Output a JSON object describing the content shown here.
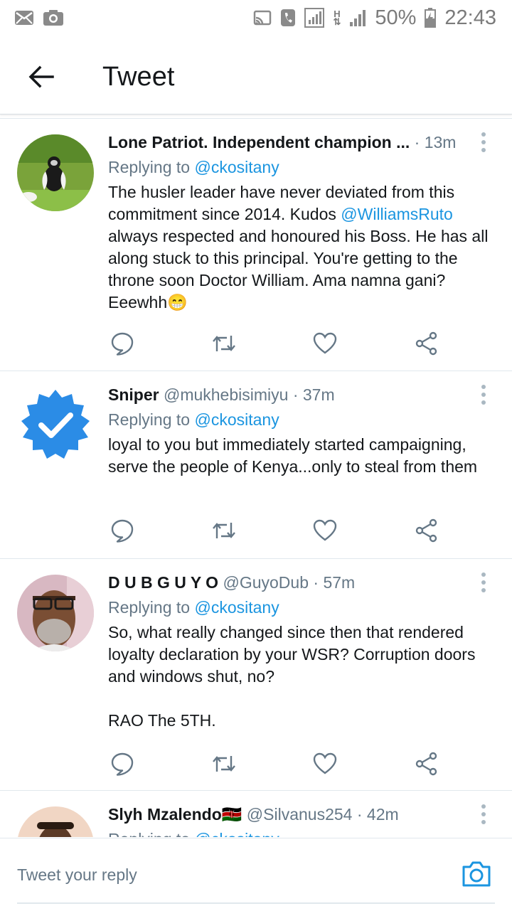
{
  "status_bar": {
    "battery": "50%",
    "time": "22:43",
    "network": "H"
  },
  "app_bar": {
    "title": "Tweet"
  },
  "tweets": [
    {
      "name": "Lone Patriot. Independent champion ...",
      "handle": "",
      "time": "13m",
      "replying_label": "Replying to ",
      "replying_to": "@ckositany",
      "lines": [
        "The husler leader have never deviated from this commitment since 2014. Kudos ",
        "@WilliamsRuto",
        " always respected and honoured his Boss. He has all along stuck to this principal. You're getting to the throne soon Doctor William. Ama namna gani? Eeewhh😁"
      ]
    },
    {
      "name": "Sniper",
      "handle": "@mukhebisimiyu",
      "time": "37m",
      "replying_label": "Replying to ",
      "replying_to": "@ckositany",
      "text": "loyal to you but immediately started campaigning, serve the people of Kenya...only to steal from them"
    },
    {
      "name": "D U B G U Y O",
      "handle": "@GuyoDub",
      "time": "57m",
      "replying_label": "Replying to ",
      "replying_to": "@ckositany",
      "text": "So, what really changed since then that rendered loyalty declaration by your WSR? Corruption doors and windows shut, no?",
      "text2": "RAO The 5TH."
    },
    {
      "name": "Slyh Mzalendo🇰🇪",
      "handle": "@Silvanus254",
      "time": "42m",
      "replying_label": "Replying to ",
      "replying_to": "@ckositany"
    }
  ],
  "reply_bar": {
    "placeholder": "Tweet your reply"
  },
  "colors": {
    "accent": "#1b95e0",
    "muted": "#657786",
    "divider": "#e1e8ed"
  }
}
